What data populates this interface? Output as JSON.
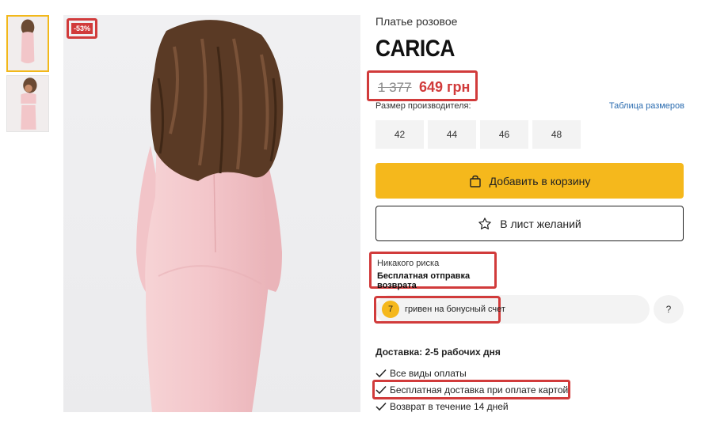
{
  "product": {
    "subtitle": "Платье розовое",
    "title": "CARICA",
    "discount_badge": "-53%",
    "old_price": "1 377",
    "new_price": "649 грн"
  },
  "sizes": {
    "label": "Размер производителя:",
    "table_link": "Таблица размеров",
    "options": [
      "42",
      "44",
      "46",
      "48"
    ]
  },
  "actions": {
    "add_to_cart": "Добавить в корзину",
    "wishlist": "В лист желаний"
  },
  "risk": {
    "line1": "Никакого риска",
    "line2": "Бесплатная отправка возврата"
  },
  "bonus": {
    "amount": "7",
    "text": "гривен на бонусный счет",
    "help": "?"
  },
  "delivery": {
    "title": "Доставка: 2-5 рабочих дня",
    "features": [
      "Все виды оплаты",
      "Бесплатная доставка при оплате картой",
      "Возврат в течение 14 дней"
    ]
  },
  "colors": {
    "accent": "#f5b81c",
    "price_red": "#d13b3b",
    "highlight_outline": "#d13b3b",
    "dress_pink": "#f3c9cc"
  },
  "icons": {
    "cart": "shopping-bag-icon",
    "wishlist": "star-icon",
    "check": "check-icon"
  }
}
